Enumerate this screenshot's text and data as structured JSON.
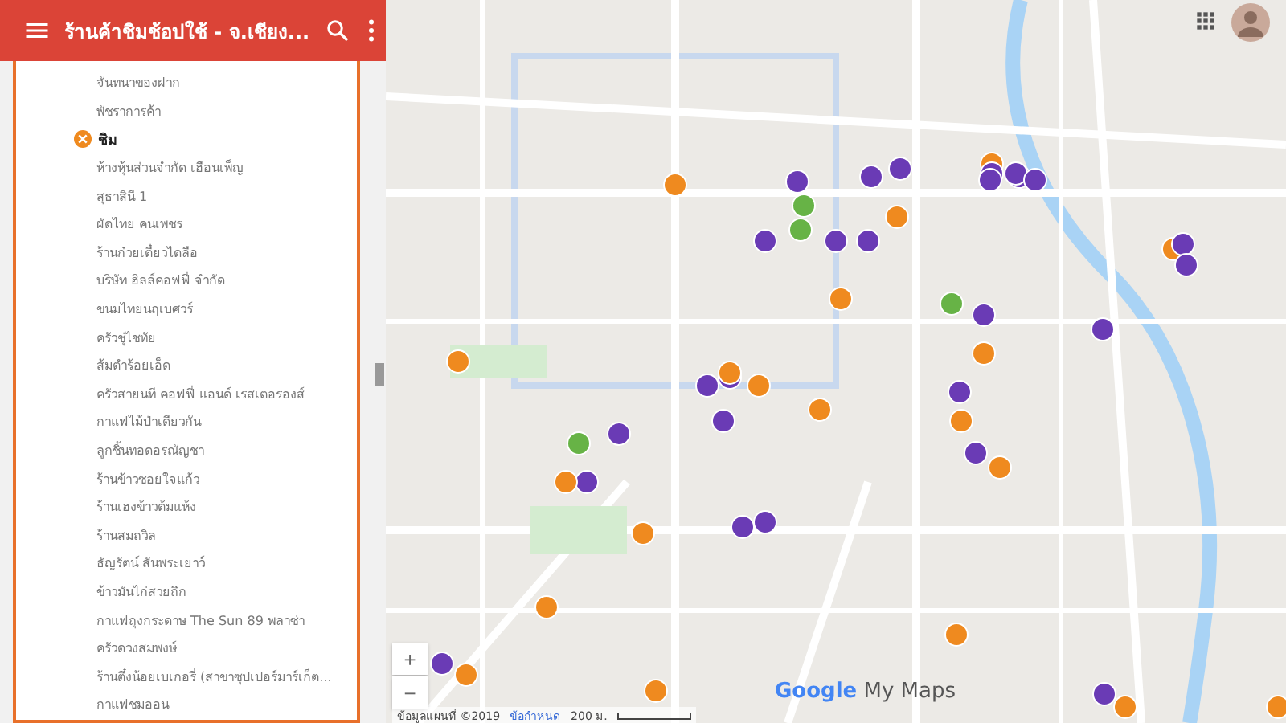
{
  "header": {
    "title": "ร้านค้าชิมช้อปใช้ - จ.เชียง..."
  },
  "sidebar": {
    "items": [
      {
        "kind": "place",
        "label": "จันทนาของฝาก"
      },
      {
        "kind": "place",
        "label": "พัชราการค้า"
      },
      {
        "kind": "category",
        "label": "ชิม"
      },
      {
        "kind": "place",
        "label": "ห้างหุ้นส่วนจำกัด เฮือนเพ็ญ"
      },
      {
        "kind": "place",
        "label": "สุธาสินี 1"
      },
      {
        "kind": "place",
        "label": "ผัดไทย คนเพชร"
      },
      {
        "kind": "place",
        "label": "ร้านก๋วยเตี๋ยวไดลือ"
      },
      {
        "kind": "place",
        "label": "บริษัท ฮิลล์คอฟฟี่ จำกัด"
      },
      {
        "kind": "place",
        "label": "ขนมไทยนฤเบศวร์"
      },
      {
        "kind": "place",
        "label": "ครัวชุ่ไชทัย"
      },
      {
        "kind": "place",
        "label": "ส้มตำร้อยเอ็ด"
      },
      {
        "kind": "place",
        "label": "ครัวสายนที คอฟฟี่ แอนด์ เรสเตอรองส์"
      },
      {
        "kind": "place",
        "label": "กาแฟไม้ป่าเดียวกัน"
      },
      {
        "kind": "place",
        "label": "ลูกชิ้นทอดอรณัญชา"
      },
      {
        "kind": "place",
        "label": "ร้านข้าวซอยใจแก้ว"
      },
      {
        "kind": "place",
        "label": "ร้านเฮงข้าวต้มแห้ง"
      },
      {
        "kind": "place",
        "label": "ร้านสมถวิล"
      },
      {
        "kind": "place",
        "label": "ธัญรัตน์ สันพระเยาว์"
      },
      {
        "kind": "place",
        "label": "ข้าวมันไก่สวยถึก"
      },
      {
        "kind": "place",
        "label": "กาแฟถุงกระดาษ The Sun 89 พลาซ่า"
      },
      {
        "kind": "place",
        "label": "ครัวดวงสมพงษ์"
      },
      {
        "kind": "place",
        "label": "ร้านตึ๋งน้อยเบเกอรี่ (สาขาซุปเปอร์มาร์เก็ต..."
      },
      {
        "kind": "place",
        "label": "กาแฟชมออน"
      }
    ]
  },
  "map": {
    "logo_brand": "Google",
    "logo_product": "My Maps",
    "attribution": "ข้อมูลแผนที่ ©2019",
    "terms": "ข้อกำหนด",
    "scale": "200 ม.",
    "zoom_in": "+",
    "zoom_out": "−"
  }
}
